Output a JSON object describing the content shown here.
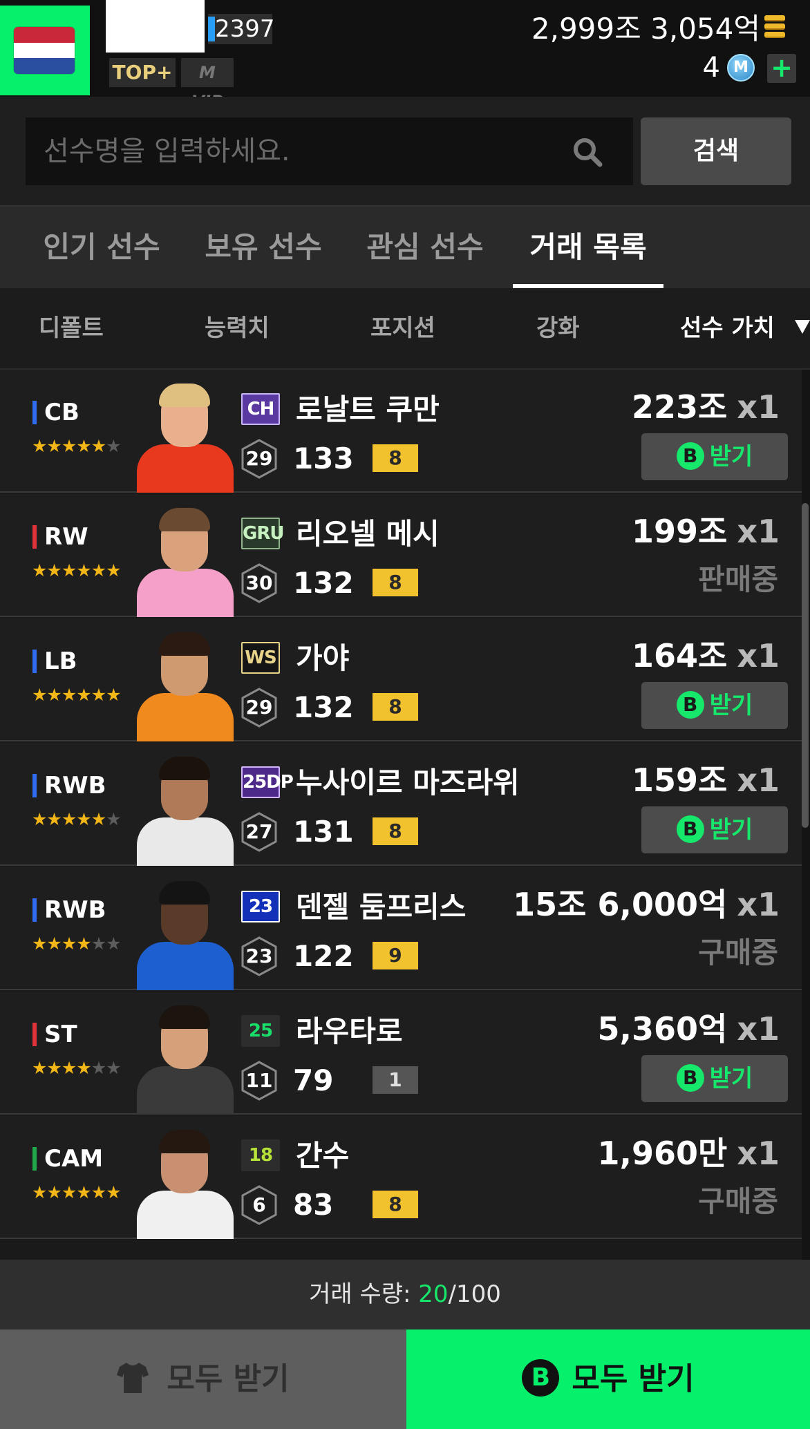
{
  "header": {
    "level": "2397",
    "tag_top": "TOP+",
    "tag_vip": "M VIP",
    "currency": "2,999조 3,054억",
    "m_count": "4",
    "m_icon_label": "M",
    "plus_label": "+",
    "flag_icon": "netherlands-flag-icon"
  },
  "search": {
    "placeholder": "선수명을 입력하세요.",
    "button_label": "검색"
  },
  "tabs": [
    {
      "label": "인기 선수",
      "active": false
    },
    {
      "label": "보유 선수",
      "active": false
    },
    {
      "label": "관심 선수",
      "active": false
    },
    {
      "label": "거래 목록",
      "active": true
    }
  ],
  "sort": [
    {
      "label": "디폴트",
      "active": false
    },
    {
      "label": "능력치",
      "active": false
    },
    {
      "label": "포지션",
      "active": false
    },
    {
      "label": "강화",
      "active": false
    },
    {
      "label": "선수 가치",
      "active": true
    }
  ],
  "colors": {
    "accent_green": "#07f06c",
    "gold": "#f2b616",
    "defender": "#2f6cf0",
    "forward": "#e0333b",
    "midfielder": "#21a84a"
  },
  "players": [
    {
      "pos": "CB",
      "pos_color": "#2f6cf0",
      "stars": 5,
      "max_stars": 6,
      "season": "CH",
      "name": "로날트 쿠만",
      "age": "29",
      "ovr": "133",
      "upgrade": "8",
      "price": "223조",
      "qty": "x1",
      "action": "receive",
      "action_label": "받기",
      "status": ""
    },
    {
      "pos": "RW",
      "pos_color": "#e0333b",
      "stars": 6,
      "max_stars": 6,
      "season": "GRU",
      "name": "리오넬 메시",
      "age": "30",
      "ovr": "132",
      "upgrade": "8",
      "price": "199조",
      "qty": "x1",
      "action": "status",
      "action_label": "",
      "status": "판매중"
    },
    {
      "pos": "LB",
      "pos_color": "#2f6cf0",
      "stars": 6,
      "max_stars": 6,
      "season": "WS",
      "name": "가야",
      "age": "29",
      "ovr": "132",
      "upgrade": "8",
      "price": "164조",
      "qty": "x1",
      "action": "receive",
      "action_label": "받기",
      "status": ""
    },
    {
      "pos": "RWB",
      "pos_color": "#2f6cf0",
      "stars": 5,
      "max_stars": 6,
      "season": "25DP",
      "name": "누사이르 마즈라위",
      "age": "27",
      "ovr": "131",
      "upgrade": "8",
      "price": "159조",
      "qty": "x1",
      "action": "receive",
      "action_label": "받기",
      "status": ""
    },
    {
      "pos": "RWB",
      "pos_color": "#2f6cf0",
      "stars": 4,
      "max_stars": 6,
      "season": "23",
      "name": "덴젤 둠프리스",
      "age": "23",
      "ovr": "122",
      "upgrade": "9",
      "price": "15조 6,000억",
      "qty": "x1",
      "action": "status",
      "action_label": "",
      "status": "구매중"
    },
    {
      "pos": "ST",
      "pos_color": "#e0333b",
      "stars": 4,
      "max_stars": 6,
      "season": "25",
      "name": "라우타로",
      "age": "11",
      "ovr": "79",
      "upgrade": "1",
      "price": "5,360억",
      "qty": "x1",
      "action": "receive",
      "action_label": "받기",
      "status": ""
    },
    {
      "pos": "CAM",
      "pos_color": "#21a84a",
      "stars": 6,
      "max_stars": 6,
      "season": "18",
      "name": "간수",
      "age": "6",
      "ovr": "83",
      "upgrade": "8",
      "price": "1,960만",
      "qty": "x1",
      "action": "status",
      "action_label": "",
      "status": "구매중"
    }
  ],
  "footer": {
    "trade_label": "거래 수량: ",
    "trade_current": "20",
    "trade_max": "/100",
    "receive_all_shirt": "모두 받기",
    "receive_all_b": "모두 받기",
    "b_icon_label": "B"
  }
}
